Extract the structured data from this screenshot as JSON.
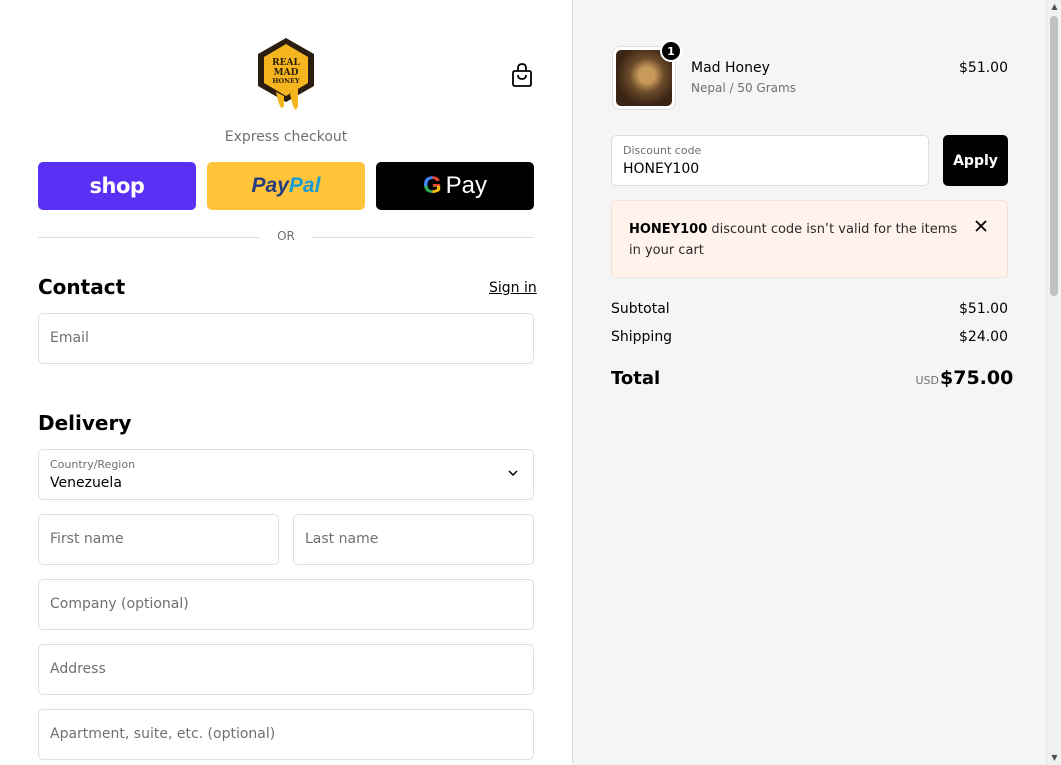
{
  "brand": {
    "logo_text": [
      "REAL",
      "MAD",
      "HONEY"
    ]
  },
  "express": {
    "label": "Express checkout",
    "shop_label": "shop",
    "paypal_part1": "Pay",
    "paypal_part2": "Pal",
    "gpay_g": "G",
    "gpay_label": "Pay",
    "or_label": "OR"
  },
  "contact": {
    "heading": "Contact",
    "signin_label": "Sign in",
    "email_placeholder": "Email"
  },
  "delivery": {
    "heading": "Delivery",
    "country_label": "Country/Region",
    "country_value": "Venezuela",
    "first_name_placeholder": "First name",
    "last_name_placeholder": "Last name",
    "company_placeholder": "Company (optional)",
    "address_placeholder": "Address",
    "apartment_placeholder": "Apartment, suite, etc. (optional)"
  },
  "order": {
    "item": {
      "quantity": "1",
      "name": "Mad Honey",
      "variant": "Nepal / 50 Grams",
      "price": "$51.00"
    },
    "discount": {
      "label": "Discount code",
      "value": "HONEY100",
      "apply_label": "Apply",
      "error_code": "HONEY100",
      "error_text": " discount code isn’t valid for the items in your cart"
    },
    "subtotal_label": "Subtotal",
    "subtotal_value": "$51.00",
    "shipping_label": "Shipping",
    "shipping_value": "$24.00",
    "total_label": "Total",
    "total_currency": "USD",
    "total_value": "$75.00"
  },
  "colors": {
    "shop_pay": "#5a31f4",
    "paypal": "#ffc439",
    "gpay": "#000000",
    "notice_bg": "#fff3ec",
    "summary_bg": "#f5f5f5"
  },
  "icons": [
    "logo",
    "bag-icon",
    "chevron-down-icon",
    "close-icon"
  ]
}
